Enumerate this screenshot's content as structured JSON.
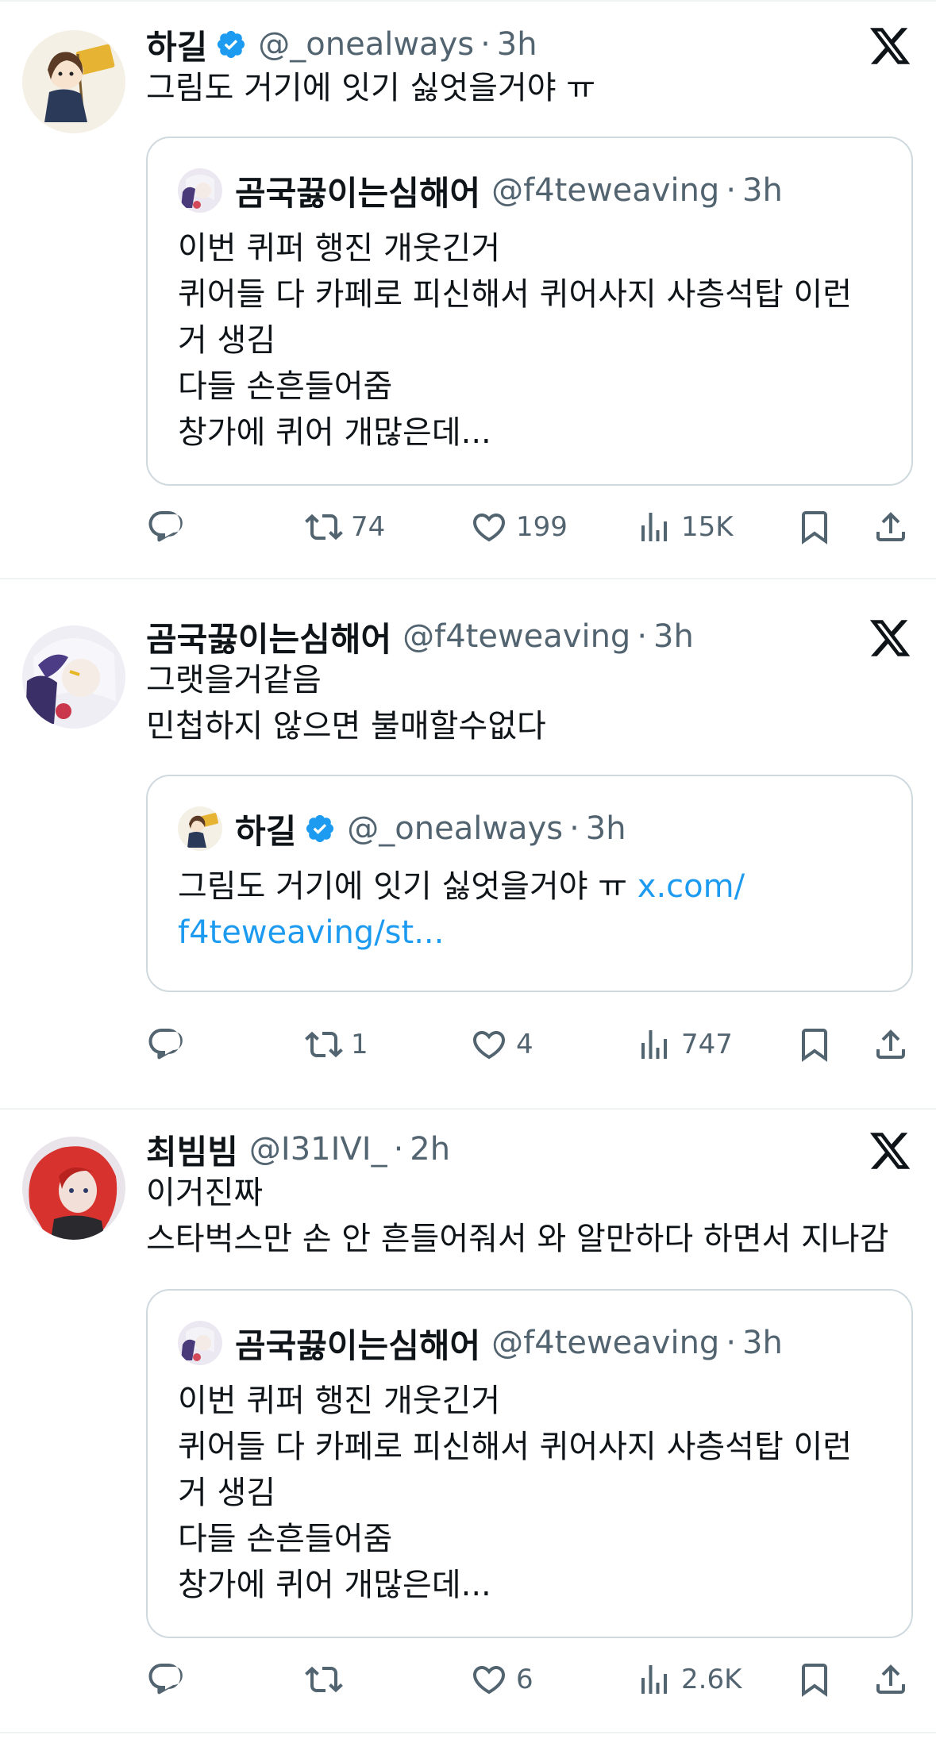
{
  "tweets": [
    {
      "name": "하길",
      "verified": true,
      "handle": "@_onealways",
      "dot": "·",
      "time": "3h",
      "text": "그림도 거기에 잇기 싫엇을거야 ㅠ",
      "quote": {
        "name": "곰국끓이는심해어",
        "handle": "@f4teweaving",
        "dot": "·",
        "time": "3h",
        "text": "이번 퀴퍼 행진 개웃긴거\n퀴어들 다 카페로 피신해서 퀴어사지 사층석탑 이런 거 생김\n다들 손흔들어줌\n창가에 퀴어 개많은데..."
      },
      "actions": {
        "replies": "",
        "reposts": "74",
        "likes": "199",
        "views": "15K"
      }
    },
    {
      "name": "곰국끓이는심해어",
      "verified": false,
      "handle": "@f4teweaving",
      "dot": "·",
      "time": "3h",
      "text": "그랫을거같음\n민첩하지 않으면 불매할수없다",
      "quote": {
        "name": "하길",
        "handle": "@_onealways",
        "dot": "·",
        "time": "3h",
        "text": "그림도 거기에 잇기 싫엇을거야 ㅠ ",
        "link": "x.com/\nf4teweaving/st..."
      },
      "actions": {
        "replies": "",
        "reposts": "1",
        "likes": "4",
        "views": "747"
      }
    },
    {
      "name": "최빔빔",
      "verified": false,
      "handle": "@I31IVI_",
      "dot": "·",
      "time": "2h",
      "text": "이거진짜\n스타벅스만 손 안 흔들어줘서 와 알만하다 하면서 지나감",
      "quote": {
        "name": "곰국끓이는심해어",
        "handle": "@f4teweaving",
        "dot": "·",
        "time": "3h",
        "text": "이번 퀴퍼 행진 개웃긴거\n퀴어들 다 카페로 피신해서 퀴어사지 사층석탑 이런 거 생김\n다들 손흔들어줌\n창가에 퀴어 개많은데..."
      },
      "actions": {
        "replies": "",
        "reposts": "",
        "likes": "6",
        "views": "2.6K"
      }
    }
  ],
  "icons": {
    "verified": "verified-badge-icon",
    "x_logo": "x-logo-icon",
    "reply": "reply-icon",
    "repost": "repost-icon",
    "like": "heart-icon",
    "views": "views-icon",
    "bookmark": "bookmark-icon",
    "share": "share-icon"
  },
  "colors": {
    "text": "#0f1419",
    "secondary": "#536471",
    "link": "#1d9bf0",
    "verified": "#1d9bf0",
    "border": "#cfd9de",
    "divider": "#eff3f4"
  }
}
